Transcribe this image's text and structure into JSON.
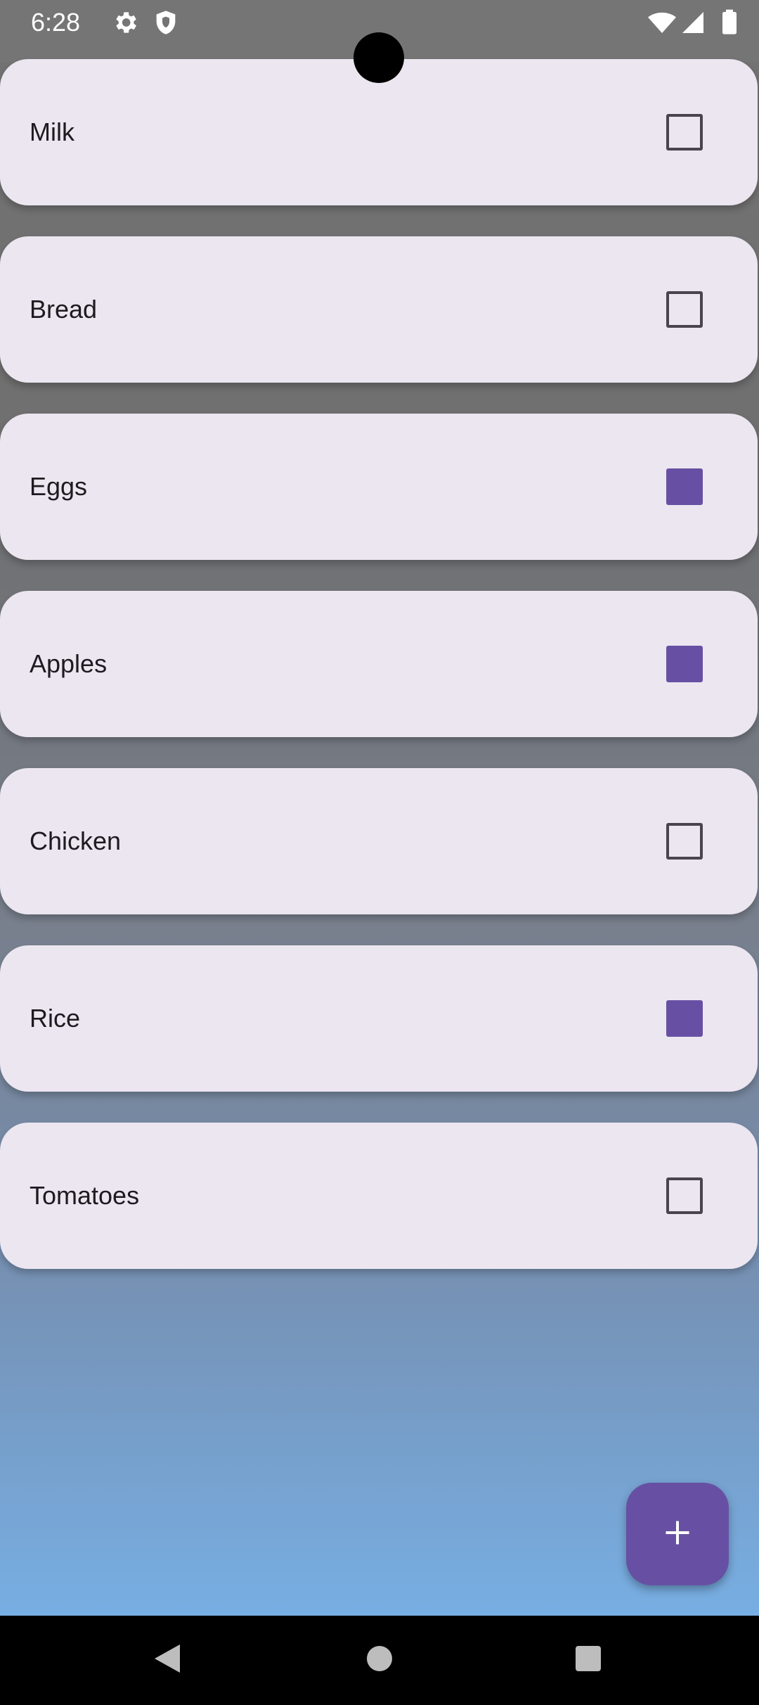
{
  "status_bar": {
    "time": "6:28",
    "icons": [
      "settings-icon",
      "shield-icon",
      "wifi-icon",
      "signal-icon",
      "battery-icon"
    ]
  },
  "list": {
    "items": [
      {
        "label": "Milk",
        "checked": false
      },
      {
        "label": "Bread",
        "checked": false
      },
      {
        "label": "Eggs",
        "checked": true
      },
      {
        "label": "Apples",
        "checked": true
      },
      {
        "label": "Chicken",
        "checked": false
      },
      {
        "label": "Rice",
        "checked": true
      },
      {
        "label": "Tomatoes",
        "checked": false
      }
    ]
  },
  "fab": {
    "icon": "plus-icon"
  },
  "nav_bar": {
    "buttons": [
      "back-icon",
      "home-icon",
      "recents-icon"
    ]
  },
  "colors": {
    "accent": "#6750a4",
    "card": "#ece6f0",
    "text": "#1d1b20",
    "checkbox_border": "#49454f"
  }
}
